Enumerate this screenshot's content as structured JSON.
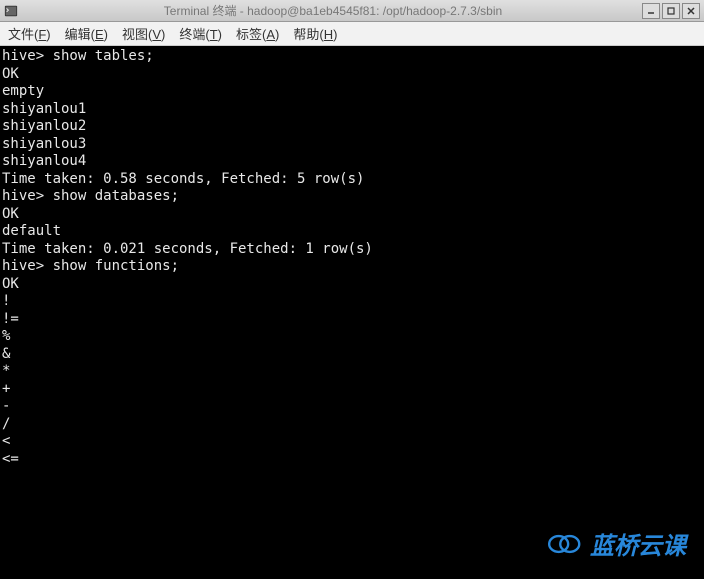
{
  "titlebar": {
    "title": "Terminal 终端 - hadoop@ba1eb4545f81: /opt/hadoop-2.7.3/sbin"
  },
  "menubar": {
    "items": [
      {
        "label": "文件(F)",
        "accel": "F"
      },
      {
        "label": "编辑(E)",
        "accel": "E"
      },
      {
        "label": "视图(V)",
        "accel": "V"
      },
      {
        "label": "终端(T)",
        "accel": "T"
      },
      {
        "label": "标签(A)",
        "accel": "A"
      },
      {
        "label": "帮助(H)",
        "accel": "H"
      }
    ]
  },
  "terminal": {
    "prompt": "hive>",
    "lines": [
      "hive> show tables;",
      "OK",
      "empty",
      "shiyanlou1",
      "shiyanlou2",
      "shiyanlou3",
      "shiyanlou4",
      "Time taken: 0.58 seconds, Fetched: 5 row(s)",
      "hive> show databases;",
      "OK",
      "default",
      "Time taken: 0.021 seconds, Fetched: 1 row(s)",
      "hive> show functions;",
      "OK",
      "!",
      "!=",
      "%",
      "&",
      "*",
      "+",
      "-",
      "/",
      "<",
      "<="
    ]
  },
  "watermark": {
    "text": "蓝桥云课"
  },
  "colors": {
    "titlebar_bg_top": "#e0e0e0",
    "titlebar_bg_bottom": "#c8c8c8",
    "menubar_bg": "#f2f2f2",
    "terminal_bg": "#000000",
    "terminal_fg": "#e8e8e8",
    "watermark_color": "#2b8fe6"
  }
}
